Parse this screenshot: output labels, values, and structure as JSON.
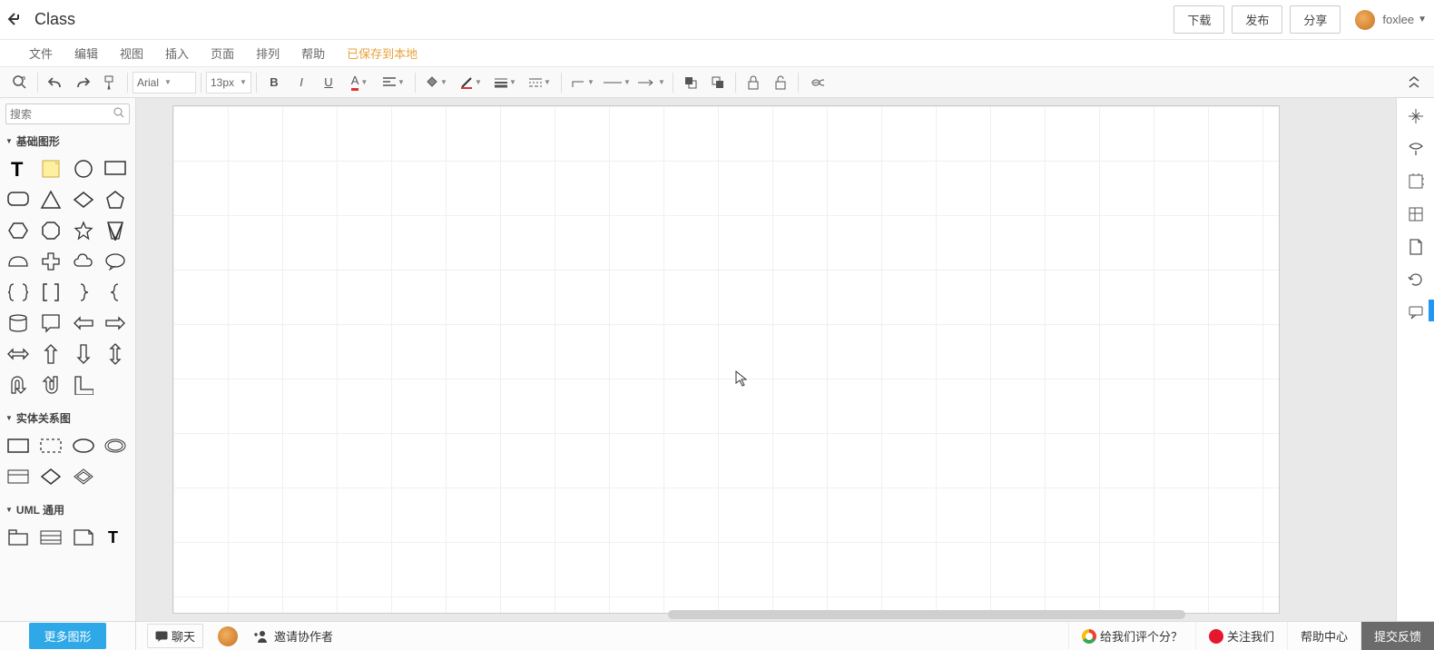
{
  "header": {
    "title": "Class",
    "buttons": {
      "download": "下载",
      "publish": "发布",
      "share": "分享"
    },
    "username": "foxlee"
  },
  "menubar": {
    "items": [
      "文件",
      "编辑",
      "视图",
      "插入",
      "页面",
      "排列",
      "帮助"
    ],
    "save_status": "已保存到本地"
  },
  "toolbar": {
    "font": "Arial",
    "size": "13px"
  },
  "search": {
    "placeholder": "搜索"
  },
  "sidebar": {
    "groups": [
      {
        "title": "基础图形"
      },
      {
        "title": "实体关系图"
      },
      {
        "title": "UML 通用"
      }
    ]
  },
  "bottom": {
    "more_shapes": "更多图形",
    "chat": "聊天",
    "invite": "邀请协作者",
    "rate": "给我们评个分？",
    "follow": "关注我们",
    "help": "帮助中心",
    "feedback": "提交反馈"
  }
}
